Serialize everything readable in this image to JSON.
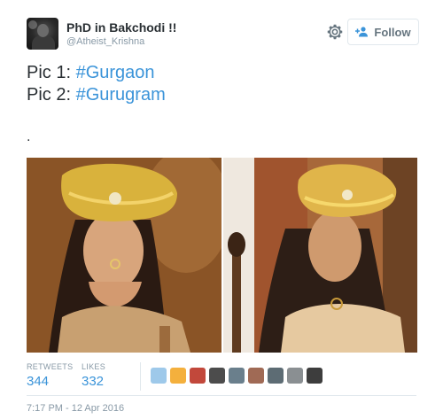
{
  "user": {
    "name": "PhD in Bakchodi !!",
    "handle": "@Atheist_Krishna"
  },
  "follow_button": {
    "label": "Follow"
  },
  "tweet": {
    "line1_prefix": "Pic 1: ",
    "line1_hashtag": "#Gurgaon",
    "line2_prefix": "Pic 2: ",
    "line2_hashtag": "#Gurugram",
    "extra": "."
  },
  "stats": {
    "retweets_label": "RETWEETS",
    "retweets": "344",
    "likes_label": "LIKES",
    "likes": "332"
  },
  "likers": [
    {
      "color": "#9ec9ea"
    },
    {
      "color": "#f4b03d"
    },
    {
      "color": "#c2483b"
    },
    {
      "color": "#4c4c4c"
    },
    {
      "color": "#6a7f8c"
    },
    {
      "color": "#a06a55"
    },
    {
      "color": "#5d6c74"
    },
    {
      "color": "#8a8f92"
    },
    {
      "color": "#3d3d3d"
    }
  ],
  "timestamp": "7:17 PM - 12 Apr 2016",
  "colors": {
    "link": "#3b94d9",
    "muted": "#8899a6",
    "text": "#292f33"
  },
  "icons": {
    "settings": "gear-icon",
    "follow": "follow-user-icon"
  }
}
